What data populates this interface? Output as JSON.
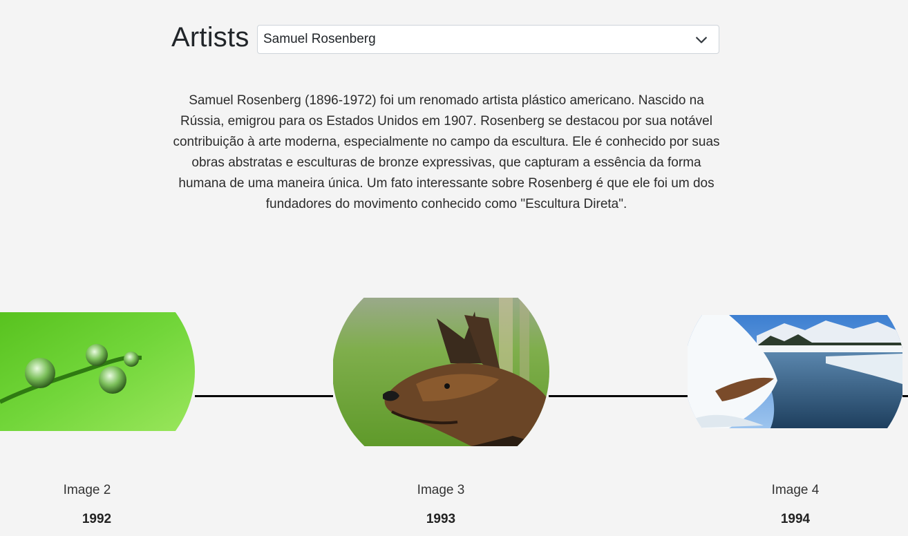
{
  "header": {
    "title": "Artists",
    "selected_artist": "Samuel Rosenberg"
  },
  "bio": "Samuel Rosenberg (1896-1972) foi um renomado artista plástico americano. Nascido na Rússia, emigrou para os Estados Unidos em 1907. Rosenberg se destacou por sua notável contribuição à arte moderna, especialmente no campo da escultura. Ele é conhecido por suas obras abstratas e esculturas de bronze expressivas, que capturam a essência da forma humana de uma maneira única. Um fato interessante sobre Rosenberg é que ele foi um dos fundadores do movimento conhecido como \"Escultura Direta\".",
  "timeline": {
    "items": [
      {
        "label": "Image 2",
        "year": "1992",
        "subject": "water droplets on green stem"
      },
      {
        "label": "Image 3",
        "year": "1993",
        "subject": "german shepherd dog"
      },
      {
        "label": "Image 4",
        "year": "1994",
        "subject": "snowy river landscape"
      }
    ]
  },
  "colors": {
    "background": "#f4f4f4",
    "line": "#000000"
  }
}
